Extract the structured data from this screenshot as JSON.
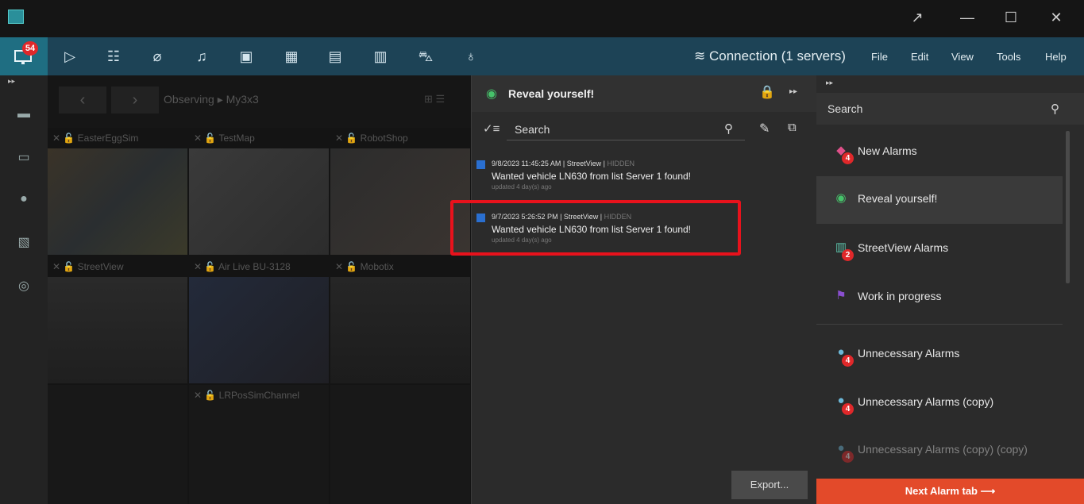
{
  "window": {
    "minimize": "—",
    "maximize": "☐",
    "close": "✕",
    "restore_icon": "↗"
  },
  "toolbar": {
    "badge": "54",
    "connection": "Connection (1 servers)",
    "menu": [
      "File",
      "Edit",
      "View",
      "Tools",
      "Help"
    ]
  },
  "video": {
    "observing": "Observing ▸ My3x3",
    "cells": [
      {
        "title": "EasterEggSim"
      },
      {
        "title": "TestMap"
      },
      {
        "title": "RobotShop"
      },
      {
        "title": "StreetView"
      },
      {
        "title": "Air Live BU-3128"
      },
      {
        "title": "Mobotix"
      },
      {
        "title": ""
      },
      {
        "title": "LRPosSimChannel"
      },
      {
        "title": ""
      }
    ]
  },
  "alarm_panel": {
    "title": "Reveal yourself!",
    "search_placeholder": "Search",
    "alarms": [
      {
        "datetime": "9/8/2023 11:45:25 AM",
        "source": "StreetView",
        "status": "HIDDEN",
        "message": "Wanted vehicle LN630 from list Server 1 found!",
        "updated": "updated 4 day(s) ago"
      },
      {
        "datetime": "9/7/2023 5:26:52 PM",
        "source": "StreetView",
        "status": "HIDDEN",
        "message": "Wanted vehicle LN630 from list Server 1 found!",
        "updated": "updated 4 day(s) ago"
      }
    ],
    "export": "Export..."
  },
  "right_panel": {
    "search_placeholder": "Search",
    "tabs": [
      {
        "label": "New Alarms",
        "badge": "4",
        "color": "#e0508a"
      },
      {
        "label": "Reveal yourself!",
        "badge": "",
        "color": "#46c26a"
      },
      {
        "label": "StreetView Alarms",
        "badge": "2",
        "color": "#5bc0a8"
      },
      {
        "label": "Work in progress",
        "badge": "",
        "color": "#8a4fd0"
      },
      {
        "label": "Unnecessary Alarms",
        "badge": "4",
        "color": "#6cb8d8"
      },
      {
        "label": "Unnecessary Alarms  (copy)",
        "badge": "4",
        "color": "#6cb8d8"
      },
      {
        "label": "Unnecessary Alarms  (copy) (copy)",
        "badge": "4",
        "color": "#6cb8d8"
      }
    ],
    "next_tab": "Next Alarm tab ⟶"
  }
}
